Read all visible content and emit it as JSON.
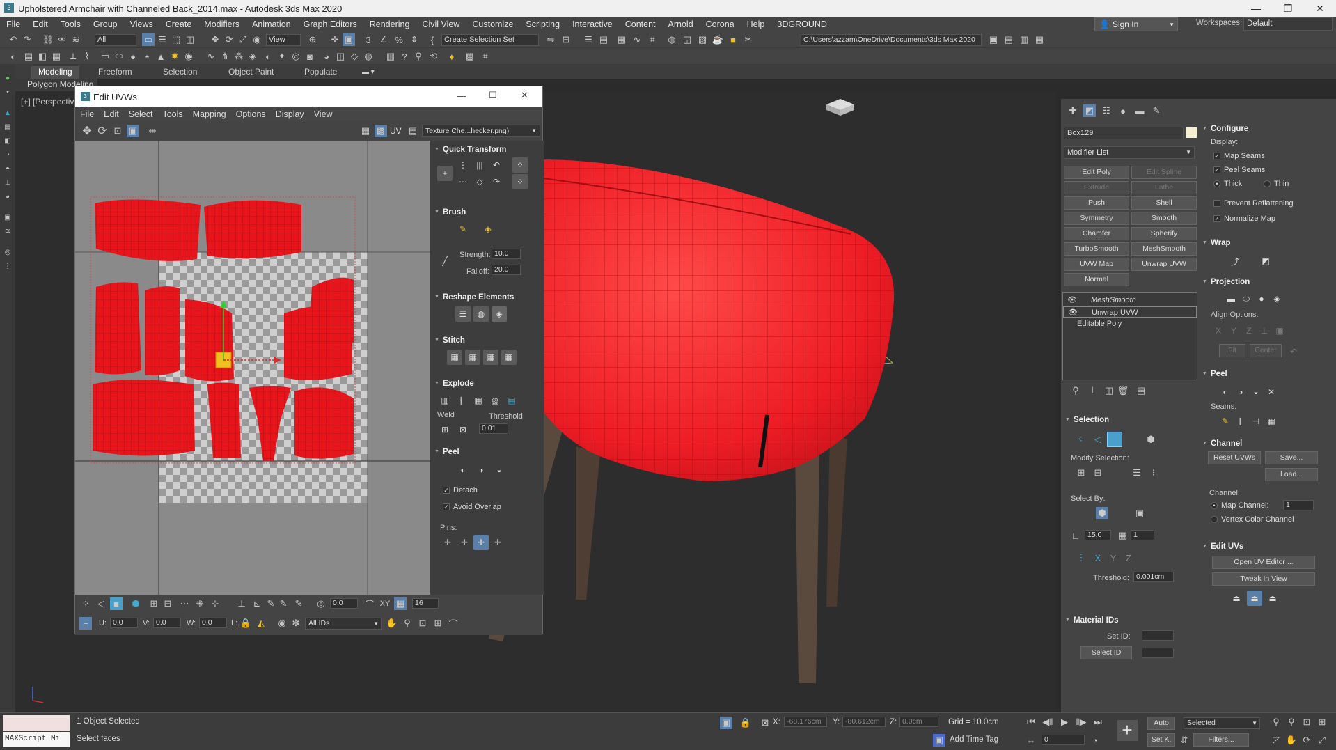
{
  "window": {
    "title": "Upholstered Armchair with Channeled Back_2014.max - Autodesk 3ds Max 2020"
  },
  "menu": [
    "File",
    "Edit",
    "Tools",
    "Group",
    "Views",
    "Create",
    "Modifiers",
    "Animation",
    "Graph Editors",
    "Rendering",
    "Civil View",
    "Customize",
    "Scripting",
    "Interactive",
    "Content",
    "Arnold",
    "Corona",
    "Help",
    "3DGROUND"
  ],
  "signin": "Sign In",
  "workspaces_label": "Workspaces:",
  "workspaces_value": "Default",
  "toolbar": {
    "filter": "All",
    "view_dropdown": "View",
    "selection_set": "Create Selection Set",
    "path": "C:\\Users\\azzam\\OneDrive\\Documents\\3ds Max 2020"
  },
  "ribbon_tabs": [
    "Modeling",
    "Freeform",
    "Selection",
    "Object Paint",
    "Populate"
  ],
  "sub_ribbon": "Polygon Modeling",
  "viewport_label": "[+] [Perspective]",
  "uv_editor": {
    "title": "Edit UVWs",
    "menu": [
      "File",
      "Edit",
      "Select",
      "Tools",
      "Mapping",
      "Options",
      "Display",
      "View"
    ],
    "uv_label": "UV",
    "texture_dropdown": "Texture Che...hecker.png)",
    "rollouts": {
      "quick_transform": "Quick Transform",
      "brush": "Brush",
      "strength_label": "Strength:",
      "strength_value": "10.0",
      "falloff_label": "Falloff:",
      "falloff_value": "20.0",
      "reshape": "Reshape Elements",
      "stitch": "Stitch",
      "explode": "Explode",
      "weld_label": "Weld",
      "threshold_label": "Threshold",
      "threshold_value": "0.01",
      "peel": "Peel",
      "detach": "Detach",
      "avoid_overlap": "Avoid Overlap",
      "pins": "Pins:"
    },
    "bottom": {
      "value1": "0.0",
      "value2": "16",
      "u_label": "U:",
      "u_value": "0.0",
      "v_label": "V:",
      "v_value": "0.0",
      "w_label": "W:",
      "w_value": "0.0",
      "l_label": "L:",
      "ids_dropdown": "All IDs"
    }
  },
  "command_panel": {
    "object_name": "Box129",
    "modifier_list": "Modifier List",
    "modifier_buttons": [
      [
        "Edit Poly",
        "Edit Spline"
      ],
      [
        "Extrude",
        "Lathe"
      ],
      [
        "Push",
        "Shell"
      ],
      [
        "Symmetry",
        "Smooth"
      ],
      [
        "Chamfer",
        "Spherify"
      ],
      [
        "TurboSmooth",
        "MeshSmooth"
      ],
      [
        "UVW Map",
        "Unwrap UVW"
      ],
      [
        "Normal",
        ""
      ]
    ],
    "stack": [
      "MeshSmooth",
      "Unwrap UVW",
      "Editable Poly"
    ],
    "selection": {
      "header": "Selection",
      "modify_selection": "Modify Selection:",
      "select_by": "Select By:",
      "angle_value": "15.0",
      "count_value": "1",
      "threshold_label": "Threshold:",
      "threshold_value": "0.001cm"
    },
    "material_ids": {
      "header": "Material IDs",
      "set_id": "Set ID:",
      "select_id": "Select ID"
    },
    "configure": {
      "header": "Configure",
      "display": "Display:",
      "map_seams": "Map Seams",
      "peel_seams": "Peel Seams",
      "thick": "Thick",
      "thin": "Thin",
      "prevent_reflattening": "Prevent Reflattening",
      "normalize_map": "Normalize Map"
    },
    "wrap": "Wrap",
    "projection": {
      "header": "Projection",
      "align_options": "Align Options:",
      "fit": "Fit",
      "center": "Center"
    },
    "peel": {
      "header": "Peel",
      "seams": "Seams:"
    },
    "channel": {
      "header": "Channel",
      "reset_uvws": "Reset UVWs",
      "save": "Save...",
      "load": "Load...",
      "channel_label": "Channel:",
      "map_channel": "Map Channel:",
      "map_channel_value": "1",
      "vertex_color_channel": "Vertex Color Channel"
    },
    "edit_uvs": {
      "header": "Edit UVs",
      "open_uv_editor": "Open UV Editor ...",
      "tweak_in_view": "Tweak In View"
    }
  },
  "status": {
    "objects_selected": "1 Object Selected",
    "prompt": "Select faces",
    "maxscript": "MAXScript Mi",
    "x_label": "X:",
    "x_value": "-68.176cm",
    "y_label": "Y:",
    "y_value": "-80.612cm",
    "z_label": "Z:",
    "z_value": "0.0cm",
    "grid": "Grid = 10.0cm",
    "add_time_tag": "Add Time Tag",
    "auto": "Auto",
    "selected": "Selected",
    "set_k": "Set K.",
    "filters": "Filters...",
    "frame": "0"
  },
  "colors": {
    "uv_shell": "#e8141a",
    "mesh": "#ee1c25",
    "legs": "#4e3e34",
    "highlight": "#f0c020"
  }
}
